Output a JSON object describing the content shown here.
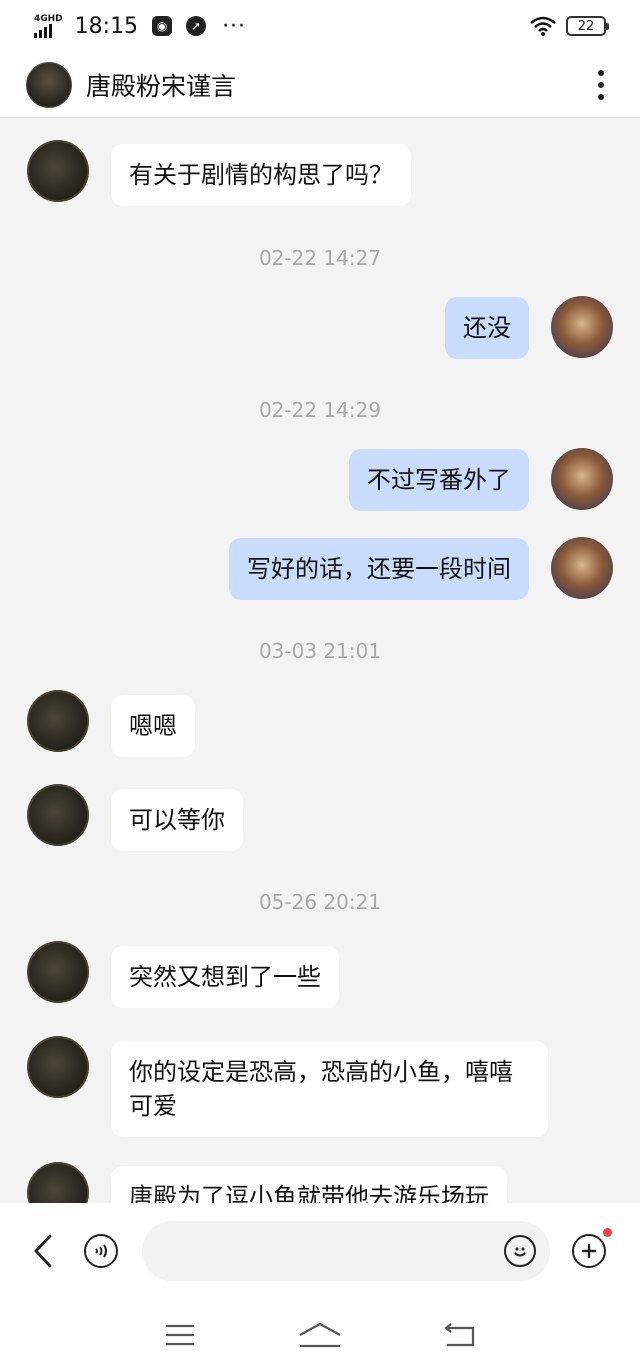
{
  "status_bar": {
    "network": "4GHD",
    "time": "18:15",
    "more": "···",
    "battery": "22"
  },
  "header": {
    "title": "唐殿粉宋谨言"
  },
  "messages": [
    {
      "type": "msg",
      "side": "them",
      "text": "有关于剧情的构思了吗？"
    },
    {
      "type": "time",
      "text": "02-22 14:27"
    },
    {
      "type": "msg",
      "side": "me",
      "text": "还没"
    },
    {
      "type": "time",
      "text": "02-22 14:29"
    },
    {
      "type": "msg",
      "side": "me",
      "text": "不过写番外了"
    },
    {
      "type": "msg",
      "side": "me",
      "text": "写好的话，还要一段时间"
    },
    {
      "type": "time",
      "text": "03-03 21:01"
    },
    {
      "type": "msg",
      "side": "them",
      "text": "嗯嗯"
    },
    {
      "type": "msg",
      "side": "them",
      "text": "可以等你"
    },
    {
      "type": "time",
      "text": "05-26 20:21"
    },
    {
      "type": "msg",
      "side": "them",
      "text": "突然又想到了一些"
    },
    {
      "type": "msg",
      "side": "them",
      "text": "你的设定是恐高，恐高的小鱼，嘻嘻可爱"
    },
    {
      "type": "msg",
      "side": "them",
      "text": "唐殿为了逗小鱼就带他去游乐场玩"
    }
  ],
  "input_bar": {
    "placeholder": ""
  },
  "colors": {
    "my_bubble": "#c9dcfb",
    "their_bubble": "#ffffff",
    "background": "#f3f3f3",
    "timestamp": "#a9a9a9"
  }
}
